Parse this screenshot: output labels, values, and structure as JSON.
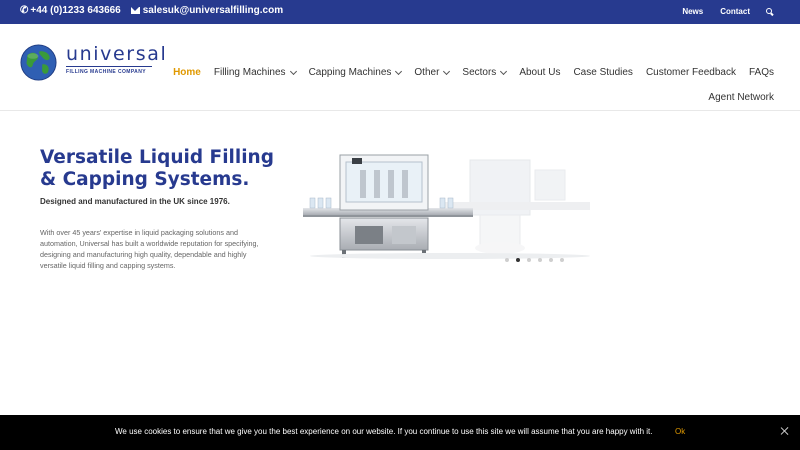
{
  "topbar": {
    "phone": "+44 (0)1233 643666",
    "email": "salesuk@universalfilling.com",
    "links": [
      "News",
      "Contact"
    ]
  },
  "logo": {
    "word": "universal",
    "sub": "FILLING MACHINE COMPANY"
  },
  "nav": {
    "items": [
      {
        "label": "Home"
      },
      {
        "label": "Filling Machines"
      },
      {
        "label": "Capping Machines"
      },
      {
        "label": "Other"
      },
      {
        "label": "Sectors"
      },
      {
        "label": "About Us"
      },
      {
        "label": "Case Studies"
      },
      {
        "label": "Customer Feedback"
      },
      {
        "label": "FAQs"
      }
    ],
    "second_row": "Agent Network"
  },
  "hero": {
    "title": "Versatile Liquid Filling & Capping Systems.",
    "subtitle": "Designed and manufactured in the UK since 1976.",
    "body": "With over 45 years' expertise in liquid packaging solutions and automation, Universal has built a worldwide reputation for specifying, designing and manufacturing high quality, dependable and highly versatile liquid filling and capping systems."
  },
  "slider": {
    "active_dot": 2,
    "dot_count": 6
  },
  "cookie": {
    "message": "We use cookies to ensure that we give you the best experience on our website. If you continue to use this site we will assume that you are happy with it.",
    "ok": "Ok"
  },
  "colors": {
    "brand_blue": "#273a8f",
    "accent": "#e09900"
  }
}
